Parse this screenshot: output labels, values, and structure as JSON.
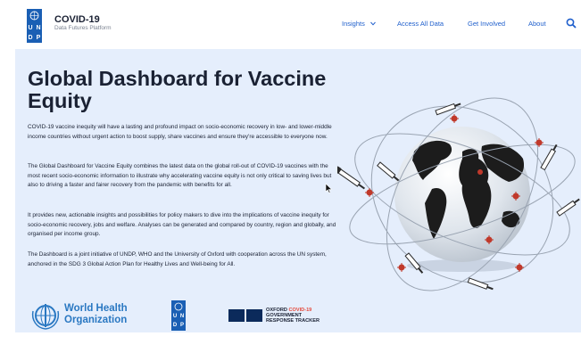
{
  "brand": {
    "title": "COVID-19",
    "subtitle": "Data Futures Platform",
    "logo_letters": [
      "U",
      "N",
      "D",
      "P"
    ]
  },
  "nav": {
    "items": [
      {
        "label": "Insights",
        "has_dropdown": true
      },
      {
        "label": "Access All Data"
      },
      {
        "label": "Get Involved"
      },
      {
        "label": "About"
      }
    ],
    "search_icon": "search-icon"
  },
  "hero": {
    "title": "Global Dashboard for Vaccine Equity",
    "paragraphs": [
      "COVID-19 vaccine inequity will have a lasting and profound impact on socio-economic recovery in low- and lower-middle income countries without urgent action to boost supply, share vaccines and ensure they're accessible to everyone now.",
      "The Global Dashboard for Vaccine Equity combines the latest data on the global roll-out of COVID-19 vaccines with the most recent socio-economic information to illustrate why accelerating vaccine equity is not only critical to saving lives but also to driving a faster and fairer recovery from the pandemic with benefits for all.",
      "It provides new, actionable insights and possibilities for policy makers to dive into the implications of vaccine inequity for socio-economic recovery, jobs and welfare. Analyses can be generated and compared by country, region and globally, and organised per income group.",
      "The Dashboard is a joint initiative of UNDP, WHO and the University of Oxford with cooperation across the UN system, anchored in the SDG 3 Global Action Plan for Healthy Lives and Well-being for All."
    ]
  },
  "partners": {
    "who": {
      "line1": "World Health",
      "line2": "Organization"
    },
    "undp_letters": [
      "U",
      "N",
      "D",
      "P"
    ],
    "oxford": {
      "line1a": "OXFORD ",
      "line1b": "COVID-19",
      "line2": "GOVERNMENT",
      "line3": "RESPONSE TRACKER"
    }
  },
  "colors": {
    "nav_link": "#1f5fcc",
    "undp_blue": "#1a5fb4",
    "hero_bg": "#e5eefc",
    "who_blue": "#2a78c2",
    "oxford_red": "#e5483a",
    "virus_red": "#c0392b"
  }
}
